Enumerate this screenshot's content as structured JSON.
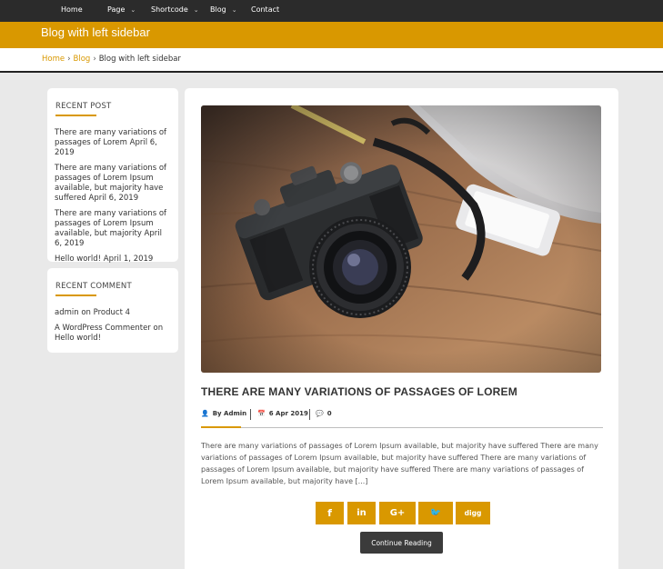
{
  "nav": {
    "items": [
      {
        "label": "Home",
        "has_submenu": false
      },
      {
        "label": "Page",
        "has_submenu": true
      },
      {
        "label": "Shortcode",
        "has_submenu": true
      },
      {
        "label": "Blog",
        "has_submenu": true
      },
      {
        "label": "Contact",
        "has_submenu": false
      }
    ],
    "caret": "⌄"
  },
  "page": {
    "title": "Blog with left sidebar"
  },
  "breadcrumb": {
    "home": "Home",
    "sep": "›",
    "blog": "Blog",
    "current": "Blog with left sidebar"
  },
  "sidebar": {
    "recent_post": {
      "title": "RECENT POST",
      "items": [
        "There are many variations of passages of Lorem April 6, 2019",
        "There are many variations of passages of Lorem Ipsum available, but majority have suffered April 6, 2019",
        "There are many variations of passages of Lorem Ipsum available, but majority April 6, 2019",
        "Hello world! April 1, 2019"
      ]
    },
    "recent_comment": {
      "title": "RECENT COMMENT",
      "items": [
        "admin on Product 4",
        "A WordPress Commenter on Hello world!"
      ]
    }
  },
  "post": {
    "title": "THERE ARE MANY VARIATIONS OF PASSAGES OF LOREM",
    "author": "By Admin",
    "date": "6 Apr 2019",
    "comments": "0",
    "excerpt": "There are many variations of passages of Lorem Ipsum available, but majority have suffered There are many variations of passages of Lorem Ipsum available, but majority have suffered There are many variations of passages of Lorem Ipsum available, but majority have suffered There are many variations of passages of Lorem Ipsum available, but majority have [...]",
    "share": [
      {
        "icon": "facebook-icon",
        "label": "f"
      },
      {
        "icon": "linkedin-icon",
        "label": "in"
      },
      {
        "icon": "google-plus-icon",
        "label": "G+"
      },
      {
        "icon": "twitter-icon",
        "label": "🐦"
      },
      {
        "icon": "digg-icon",
        "label": "digg"
      }
    ],
    "continue_label": "Continue Reading"
  },
  "colors": {
    "accent": "#d99800",
    "nav_bg": "#2b2b2b",
    "page_bg": "#e9e9e9"
  }
}
